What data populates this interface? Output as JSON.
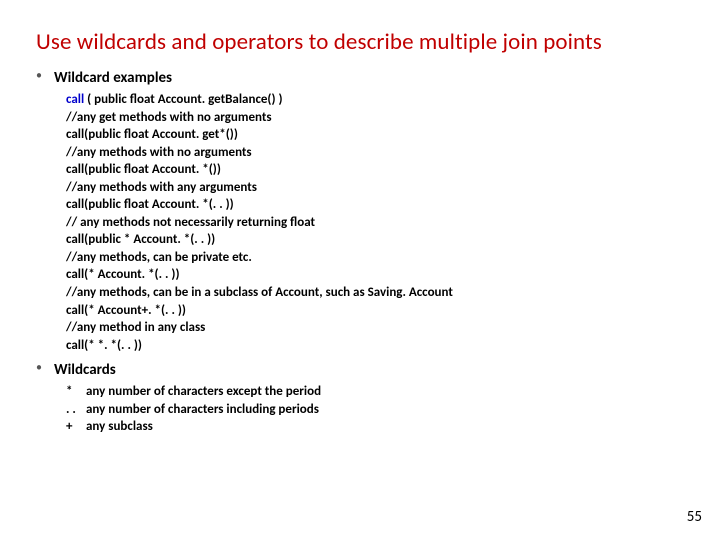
{
  "title": "Use wildcards and operators to describe multiple join points",
  "section1": {
    "label": "Wildcard examples",
    "lines": [
      {
        "prefix": "call",
        "rest": " ( public float Account. getBalance() )"
      },
      {
        "rest": "//any get methods with no arguments"
      },
      {
        "rest": "call(public float Account. get*())"
      },
      {
        "rest": "//any methods with no arguments"
      },
      {
        "rest": "call(public float Account. *())"
      },
      {
        "rest": "//any methods with any arguments"
      },
      {
        "rest": "call(public float Account. *(. . ))"
      },
      {
        "rest": "// any methods not necessarily returning float"
      },
      {
        "rest": "call(public * Account. *(. . ))"
      },
      {
        "rest": "//any methods, can be private etc."
      },
      {
        "rest": "call(* Account. *(. . ))"
      },
      {
        "rest": "//any methods, can be in a subclass of Account, such as Saving. Account"
      },
      {
        "rest": "call(* Account+. *(. . ))"
      },
      {
        "rest": "//any method in any class"
      },
      {
        "rest": "call(* *. *(. . ))"
      }
    ]
  },
  "section2": {
    "label": "Wildcards",
    "legend": [
      {
        "sym": "*",
        "desc": "any number of characters except the period"
      },
      {
        "sym": ". .",
        "desc": "any number of characters including periods"
      },
      {
        "sym": "+",
        "desc": "any subclass"
      }
    ]
  },
  "page": "55"
}
